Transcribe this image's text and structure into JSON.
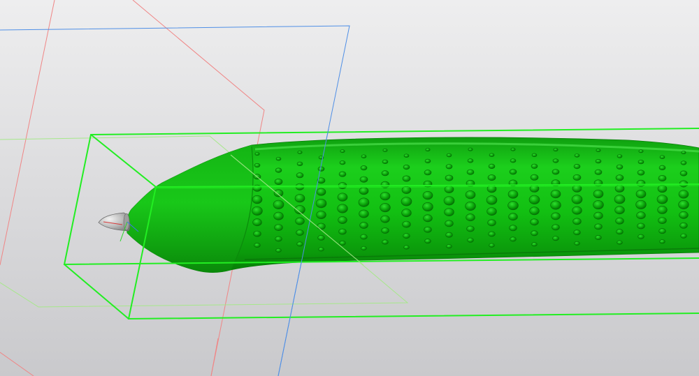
{
  "viewport": {
    "background_top": "#eeeeef",
    "background_bottom": "#c9c9cc"
  },
  "colors": {
    "body_green": "#11c211",
    "body_green_dark": "#0a8e0a",
    "body_green_light": "#3fe03f",
    "bounding_box": "#22ee22",
    "plane_red": "#f08585",
    "plane_blue": "#4f8fe6",
    "plane_lightgreen": "#a6e88a",
    "tip_gray": "#c4c4c4",
    "axis_red": "#d63a3a",
    "axis_green": "#2bd42b",
    "axis_blue": "#3a7ae6"
  },
  "model": {
    "body_shape": "elongated-perforated-probe",
    "tip_shape": "conical-nose",
    "dimple_pattern": "staggered-grid"
  }
}
